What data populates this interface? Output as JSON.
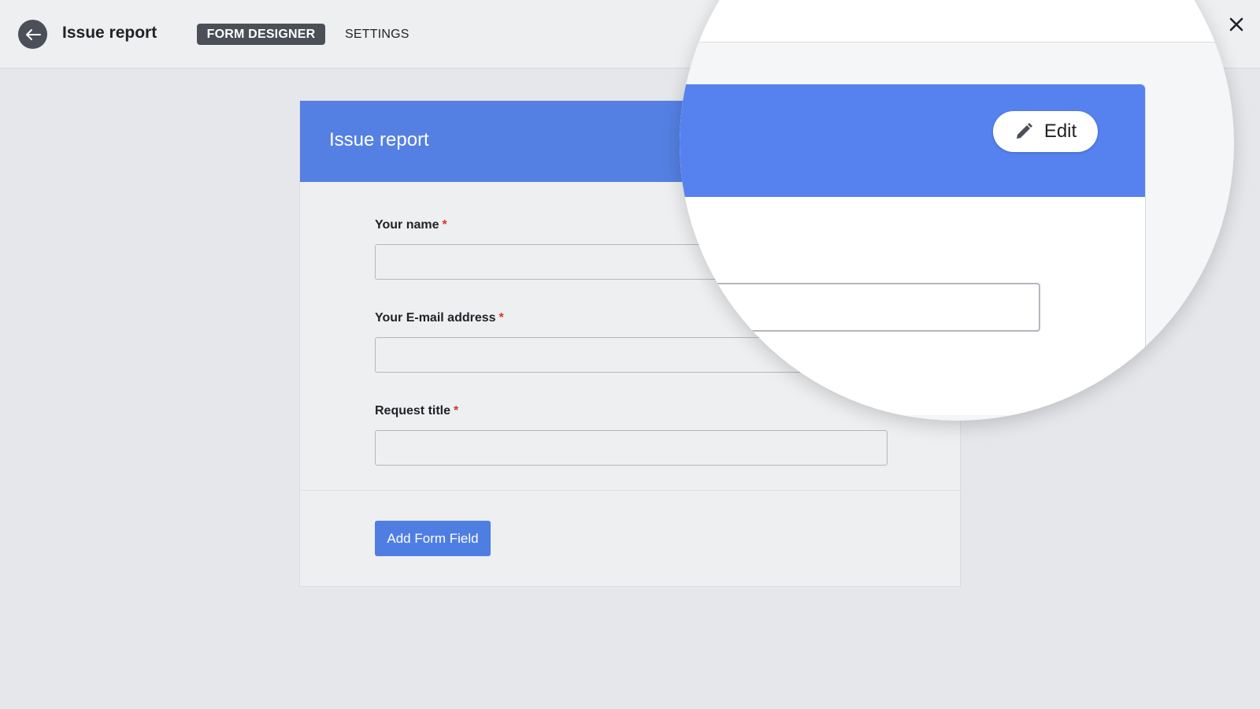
{
  "header": {
    "title": "Issue report",
    "tabs": [
      {
        "label": "FORM DESIGNER",
        "active": true
      },
      {
        "label": "SETTINGS",
        "active": false
      }
    ]
  },
  "icons": {
    "back": "arrow-left-icon",
    "close": "close-icon",
    "edit": "pencil-icon"
  },
  "form": {
    "title": "Issue report",
    "fields": [
      {
        "label": "Your name",
        "required_mark": "*",
        "value": ""
      },
      {
        "label": "Your E-mail address",
        "required_mark": "*",
        "value": ""
      },
      {
        "label": "Request title",
        "required_mark": "*",
        "value": ""
      }
    ],
    "add_field_label": "Add Form Field"
  },
  "magnifier": {
    "edit_label": "Edit"
  },
  "colors": {
    "accent": "#5580e3",
    "required": "#d9352b",
    "dark": "#4a4f58"
  }
}
